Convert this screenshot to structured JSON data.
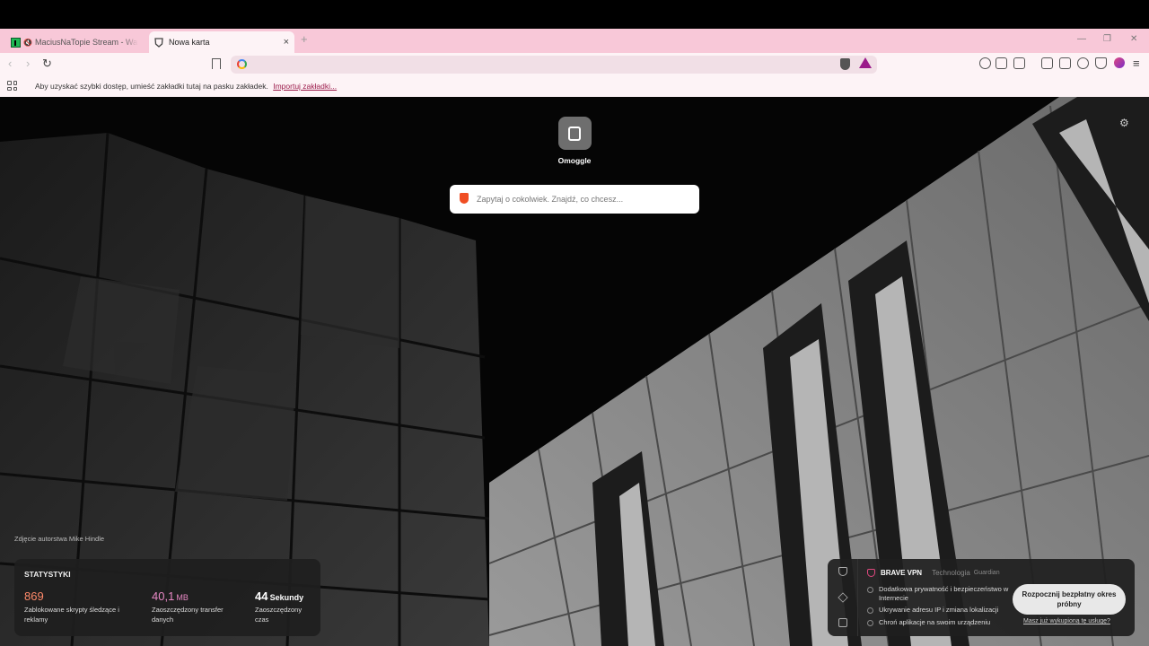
{
  "tabs": [
    {
      "title": "MaciusNaTopie Stream - Watch L",
      "muted": true,
      "active": false
    },
    {
      "title": "Nowa karta",
      "muted": false,
      "active": true
    }
  ],
  "new_tab_symbol": "+",
  "window_controls": {
    "minimize": "—",
    "restore": "❐",
    "close": "✕"
  },
  "toolbar": {
    "back_icon": "‹",
    "forward_icon": "›",
    "reload_icon": "↻",
    "menu_icon": "≡",
    "url_value": ""
  },
  "bookmarks_bar": {
    "message": "Aby uzyskać szybki dostęp, umieść zakładki tutaj na pasku zakładek.",
    "import_link": "Importuj zakładki..."
  },
  "new_tab_page": {
    "settings_icon": "⚙",
    "top_site": {
      "label": "Omoggle"
    },
    "search_placeholder": "Zapytaj o cokolwiek. Znajdź, co chcesz...",
    "photo_credit": "Zdjęcie autorstwa Mike Hindle",
    "stats": {
      "title": "STATYSTYKI",
      "items": [
        {
          "value": "869",
          "unit": "",
          "label": "Zablokowane skrypty śledzące i reklamy"
        },
        {
          "value": "40,1",
          "unit": "MB",
          "label": "Zaoszczędzony transfer danych"
        },
        {
          "value": "44",
          "unit": "Sekundy",
          "label": "Zaoszczędzony czas"
        }
      ]
    },
    "vpn": {
      "title": "BRAVE VPN",
      "tech_label": "Technologia",
      "guardian": "Guardian",
      "features": [
        "Dodatkowa prywatność i bezpieczeństwo w Internecie",
        "Ukrywanie adresu IP i zmiana lokalizacji",
        "Chroń aplikacje na swoim urządzeniu"
      ],
      "cta_button": "Rozpocznij bezpłatny okres próbny",
      "purchased_link": "Masz już wykupioną tę usługę?"
    }
  },
  "colors": {
    "tabstrip_bg": "#f8c8d8",
    "toolbar_bg": "#fdf3f6",
    "stat_trackers": "#ff8a6a",
    "stat_bandwidth": "#e889c5",
    "brave_accent": "#e0487f"
  }
}
